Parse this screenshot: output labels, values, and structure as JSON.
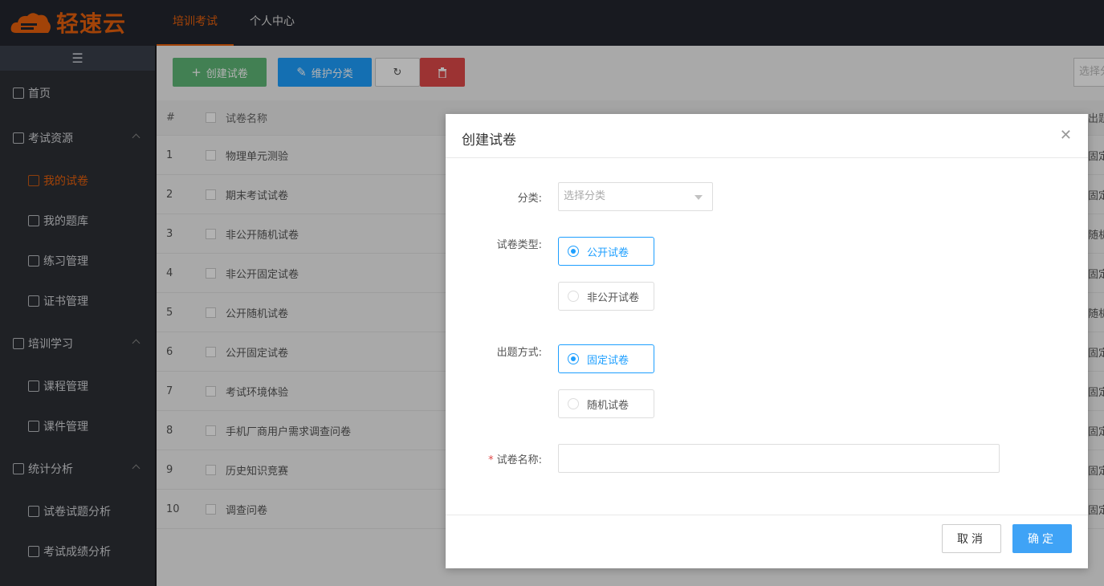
{
  "app": {
    "logo_text": "轻速云"
  },
  "topnav": [
    {
      "label": "培训考试",
      "active": true
    },
    {
      "label": "个人中心",
      "active": false
    }
  ],
  "sidebar": {
    "toggle_icon": "menu-icon",
    "home": "首页",
    "groups": [
      {
        "label": "考试资源",
        "items": [
          "我的试卷",
          "我的题库",
          "练习管理",
          "证书管理"
        ]
      },
      {
        "label": "培训学习",
        "items": [
          "课程管理",
          "课件管理"
        ]
      },
      {
        "label": "统计分析",
        "items": [
          "试卷试题分析",
          "考试成绩分析"
        ]
      }
    ]
  },
  "toolbar": {
    "create_label": "创建试卷",
    "category_label": "维护分类",
    "filter_placeholder": "选择分"
  },
  "table": {
    "headers": {
      "num": "#",
      "name": "试卷名称",
      "last": "出题"
    },
    "rows": [
      {
        "num": "1",
        "name": "物理单元测验",
        "type": "固定"
      },
      {
        "num": "2",
        "name": "期末考试试卷",
        "type": "固定"
      },
      {
        "num": "3",
        "name": "非公开随机试卷",
        "type": "随机"
      },
      {
        "num": "4",
        "name": "非公开固定试卷",
        "type": "固定"
      },
      {
        "num": "5",
        "name": "公开随机试卷",
        "type": "随机"
      },
      {
        "num": "6",
        "name": "公开固定试卷",
        "type": "固定"
      },
      {
        "num": "7",
        "name": "考试环境体验",
        "type": "固定"
      },
      {
        "num": "8",
        "name": "手机厂商用户需求调查问卷",
        "type": "固定"
      },
      {
        "num": "9",
        "name": "历史知识竞赛",
        "type": "固定"
      },
      {
        "num": "10",
        "name": "调查问卷",
        "type": "固定"
      }
    ]
  },
  "modal": {
    "title": "创建试卷",
    "category_label": "分类:",
    "category_placeholder": "选择分类",
    "paper_type_label": "试卷类型:",
    "paper_type_options": [
      "公开试卷",
      "非公开试卷"
    ],
    "paper_type_selected": "公开试卷",
    "mode_label": "出题方式:",
    "mode_options": [
      "固定试卷",
      "随机试卷"
    ],
    "mode_selected": "固定试卷",
    "name_required": "*",
    "name_label": "试卷名称:",
    "name_value": "",
    "cancel_label": "取消",
    "ok_label": "确定"
  }
}
